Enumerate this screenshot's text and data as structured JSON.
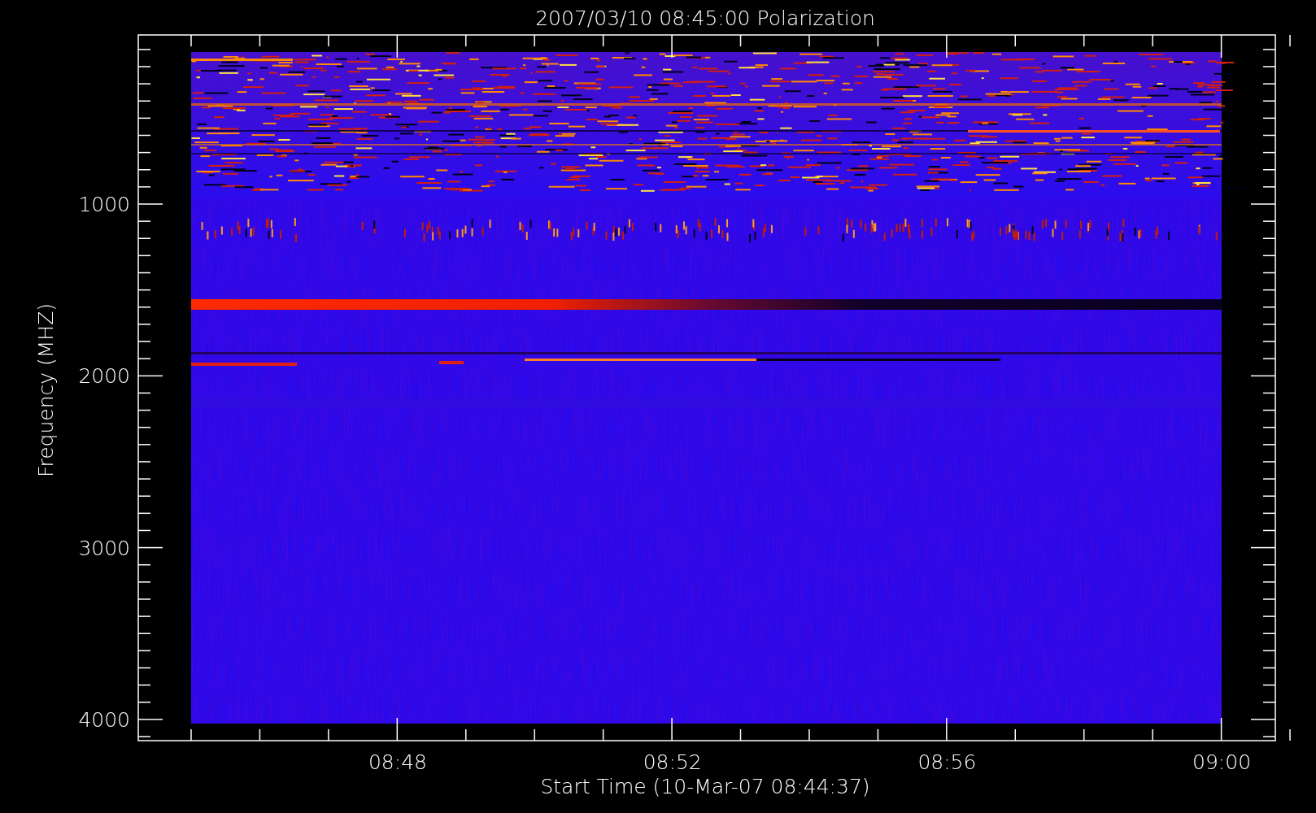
{
  "title": "2007/03/10 08:45:00 Polarization",
  "y_axis": {
    "title": "Frequency (MHZ)",
    "tick_labels": [
      "1000",
      "2000",
      "3000",
      "4000"
    ]
  },
  "x_axis": {
    "title": "Start Time (10-Mar-07 08:44:37)",
    "tick_labels": [
      "08:48",
      "08:52",
      "08:56",
      "09:00"
    ]
  }
}
